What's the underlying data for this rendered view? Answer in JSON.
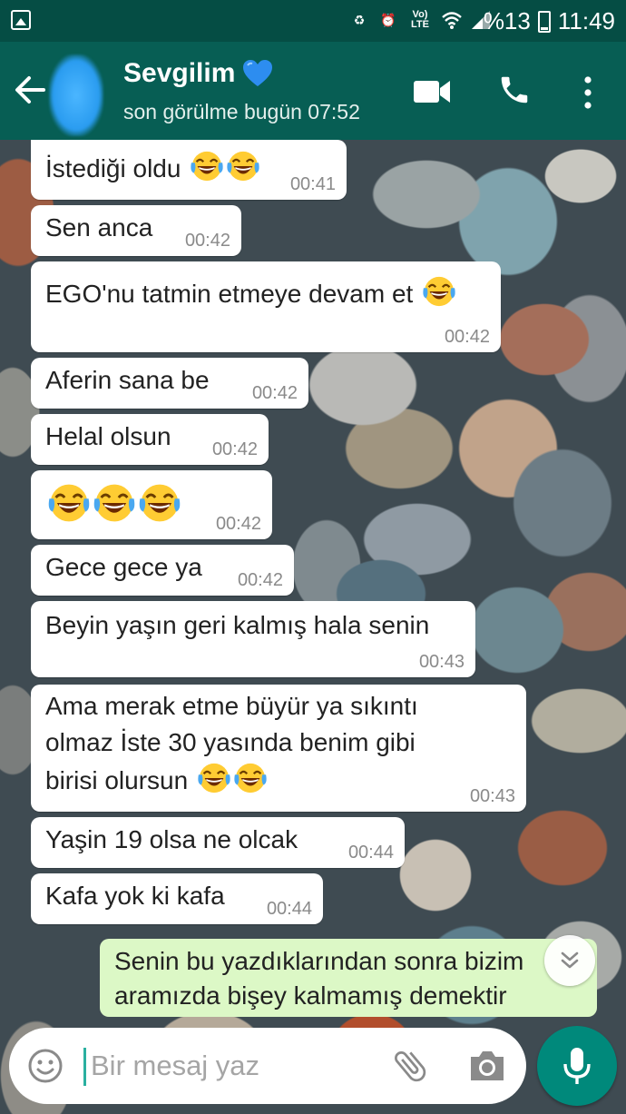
{
  "status_bar": {
    "network": "Vo) LTE",
    "battery": "%13",
    "time": "11:49"
  },
  "header": {
    "contact_name": "Sevgilim",
    "last_seen": "son görülme bugün 07:52",
    "icons": [
      "back-arrow-icon",
      "video-call-icon",
      "voice-call-icon",
      "more-options-icon"
    ]
  },
  "messages": [
    {
      "text": "İstediği oldu",
      "emoji_count": 2,
      "time": "00:41"
    },
    {
      "text": "Sen anca",
      "emoji_count": 0,
      "time": "00:42"
    },
    {
      "text": "EGO'nu tatmin etmeye devam et",
      "emoji_count": 1,
      "time": "00:42"
    },
    {
      "text": "Aferin sana be",
      "emoji_count": 0,
      "time": "00:42"
    },
    {
      "text": "Helal olsun",
      "emoji_count": 0,
      "time": "00:42"
    },
    {
      "text": "",
      "emoji_count": 3,
      "time": "00:42"
    },
    {
      "text": "Gece gece ya",
      "emoji_count": 0,
      "time": "00:42"
    },
    {
      "text": "Beyin yaşın geri kalmış hala senin",
      "emoji_count": 0,
      "time": "00:43"
    },
    {
      "lines": [
        "Ama merak etme büyür ya sıkıntı",
        "olmaz İste 30 yasında benim gibi",
        "birisi olursun"
      ],
      "emoji_count": 2,
      "time": "00:43"
    },
    {
      "text": "Yaşin 19 olsa ne olcak",
      "emoji_count": 0,
      "time": "00:44"
    },
    {
      "text": "Kafa yok ki kafa",
      "emoji_count": 0,
      "time": "00:44"
    }
  ],
  "sent_message": {
    "lines": [
      "Senin bu yazdıklarından sonra bizim",
      "aramızda bişey kalmamış demektir"
    ]
  },
  "input": {
    "placeholder": "Bir mesaj yaz",
    "value": ""
  },
  "colors": {
    "header": "#075e54",
    "status_bar": "#054d44",
    "sent_bubble": "#dcf8c6",
    "received_bubble": "#ffffff",
    "mic_button": "#00897b"
  }
}
